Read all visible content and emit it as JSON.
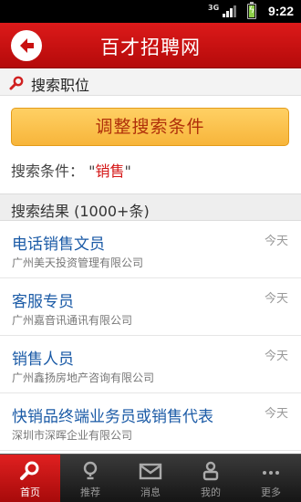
{
  "status_bar": {
    "network": "3G",
    "time": "9:22"
  },
  "header": {
    "title": "百才招聘网"
  },
  "search": {
    "section_label": "搜索职位",
    "adjust_button_label": "调整搜索条件",
    "criteria_label": "搜索条件：",
    "criteria_keyword": "销售"
  },
  "results": {
    "header_label": "搜索结果 (1000+条)",
    "jobs": [
      {
        "title": "电话销售文员",
        "company": "广州美天投资管理有限公司",
        "date": "今天"
      },
      {
        "title": "客服专员",
        "company": "广州嘉音讯通讯有限公司",
        "date": "今天"
      },
      {
        "title": "销售人员",
        "company": "广州鑫扬房地产咨询有限公司",
        "date": "今天"
      },
      {
        "title": "快销品终端业务员或销售代表",
        "company": "深圳市深晖企业有限公司",
        "date": "今天"
      }
    ]
  },
  "bottom_nav": {
    "items": [
      {
        "label": "首页",
        "icon": "search-icon",
        "active": true
      },
      {
        "label": "推荐",
        "icon": "lightbulb-icon",
        "active": false
      },
      {
        "label": "消息",
        "icon": "envelope-icon",
        "active": false
      },
      {
        "label": "我的",
        "icon": "person-icon",
        "active": false
      },
      {
        "label": "更多",
        "icon": "more-dots-icon",
        "active": false
      }
    ]
  },
  "colors": {
    "header_red": "#c81010",
    "button_orange": "#f7b53a",
    "link_blue": "#1a5aa6",
    "keyword_red": "#d41414"
  }
}
